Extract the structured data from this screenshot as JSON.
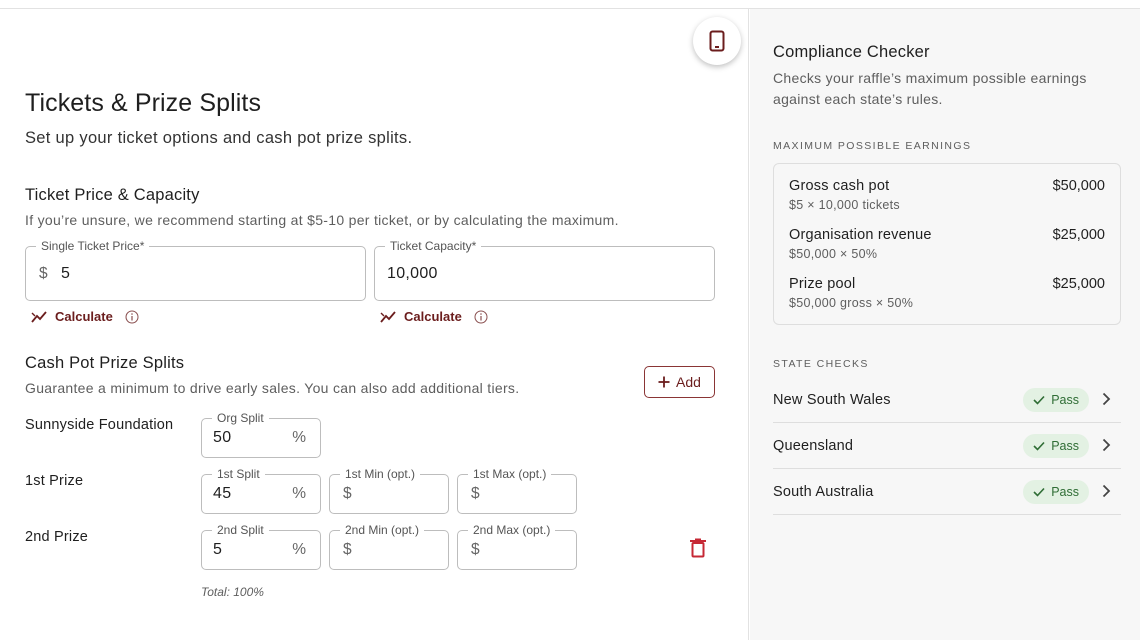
{
  "main": {
    "title": "Tickets & Prize Splits",
    "subtitle": "Set up your ticket options and cash pot prize splits.",
    "ticket_section": {
      "heading": "Ticket Price & Capacity",
      "description": "If you’re unsure, we recommend starting at $5-10 per ticket, or by calculating the maximum.",
      "price_field": {
        "label": "Single Ticket Price*",
        "prefix": "$",
        "value": "5"
      },
      "capacity_field": {
        "label": "Ticket Capacity*",
        "value": "10,000"
      },
      "calculate_label": "Calculate"
    },
    "prize_section": {
      "heading": "Cash Pot Prize Splits",
      "description": "Guarantee a minimum to drive early sales. You can also add additional tiers.",
      "add_label": "Add",
      "org": {
        "name": "Sunnyside Foundation",
        "split_label": "Org Split",
        "split_value": "50",
        "suffix": "%"
      },
      "first": {
        "name": "1st Prize",
        "split_label": "1st Split",
        "split_value": "45",
        "min_label": "1st Min (opt.)",
        "max_label": "1st Max (opt.)",
        "currency": "$",
        "suffix": "%"
      },
      "second": {
        "name": "2nd Prize",
        "split_label": "2nd Split",
        "split_value": "5",
        "min_label": "2nd Min (opt.)",
        "max_label": "2nd Max (opt.)",
        "currency": "$",
        "suffix": "%"
      },
      "total": "Total: 100%"
    }
  },
  "sidebar": {
    "title": "Compliance Checker",
    "description": "Checks your raffle’s maximum possible earnings against each state’s rules.",
    "earnings_caption": "MAXIMUM POSSIBLE EARNINGS",
    "earnings": [
      {
        "label": "Gross cash pot",
        "sub": "$5 × 10,000 tickets",
        "value": "$50,000"
      },
      {
        "label": "Organisation revenue",
        "sub": "$50,000 × 50%",
        "value": "$25,000"
      },
      {
        "label": "Prize pool",
        "sub": "$50,000 gross × 50%",
        "value": "$25,000"
      }
    ],
    "state_caption": "STATE CHECKS",
    "states": [
      {
        "name": "New South Wales",
        "status": "Pass"
      },
      {
        "name": "Queensland",
        "status": "Pass"
      },
      {
        "name": "South Australia",
        "status": "Pass"
      }
    ]
  },
  "colors": {
    "accent": "#6b1d1d",
    "danger": "#c62835",
    "pass_bg": "#e3f1e3",
    "pass_fg": "#2f6d35"
  }
}
